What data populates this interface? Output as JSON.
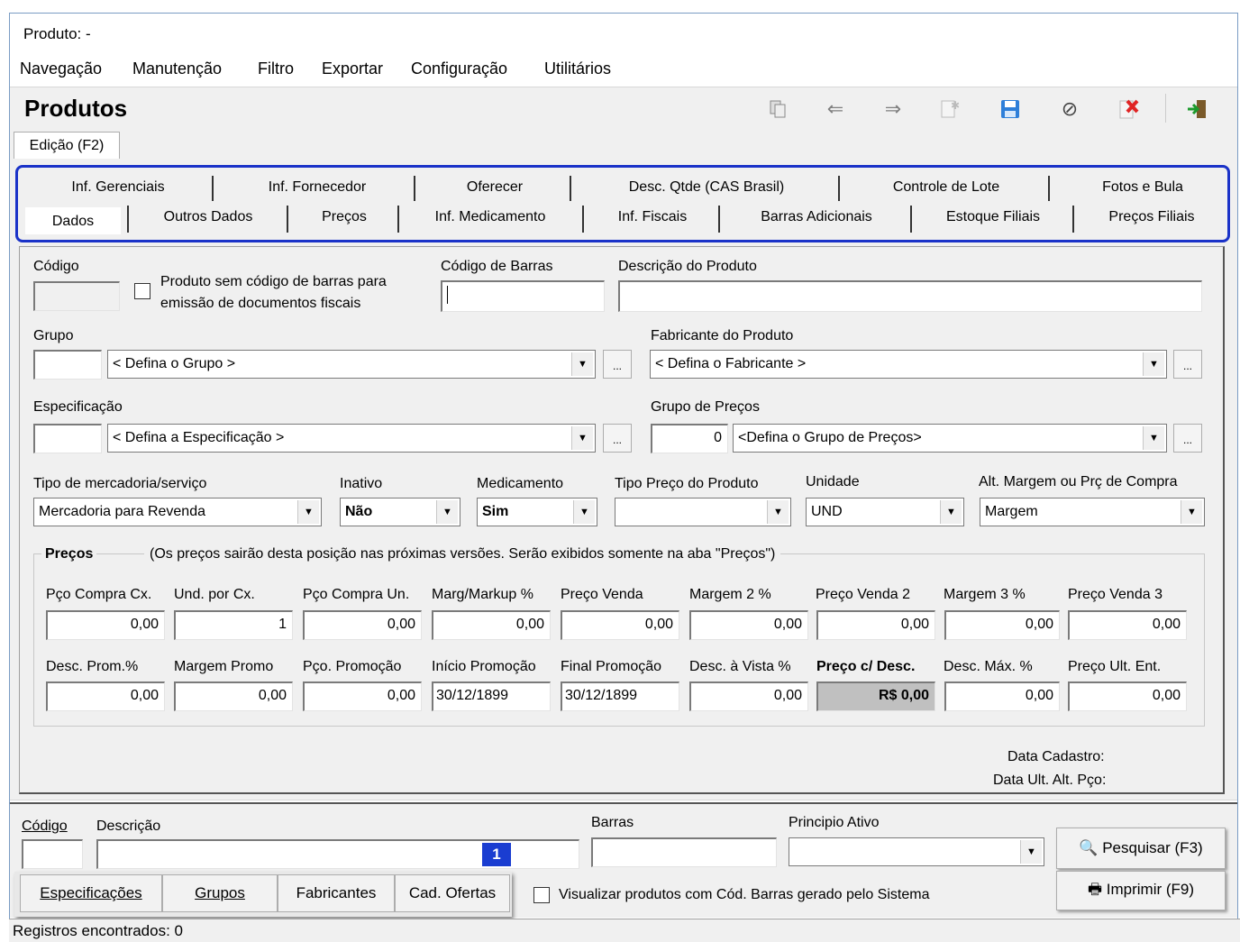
{
  "window": {
    "title": "Produto: -"
  },
  "menu": [
    "Navegação",
    "Manutenção",
    "Filtro",
    "Exportar",
    "Configuração",
    "Utilitários"
  ],
  "header": {
    "title": "Produtos"
  },
  "toolbar_icons": [
    "copy-icon",
    "arrow-left-icon",
    "arrow-right-icon",
    "new-record-icon",
    "save-icon",
    "cancel-icon",
    "delete-icon",
    "exit-icon"
  ],
  "edit_tab": "Edição (F2)",
  "tabs_row1": [
    "Inf. Gerenciais",
    "Inf. Fornecedor",
    "Oferecer",
    "Desc. Qtde (CAS Brasil)",
    "Controle de Lote",
    "Fotos e Bula"
  ],
  "tabs_row2": [
    "Dados",
    "Outros Dados",
    "Preços",
    "Inf. Medicamento",
    "Inf. Fiscais",
    "Barras Adicionais",
    "Estoque Filiais",
    "Preços Filiais"
  ],
  "form": {
    "codigo_label": "Código",
    "sem_barras_line1": "Produto sem código de barras para",
    "sem_barras_line2": "emissão de documentos fiscais",
    "codigo_barras_label": "Código de Barras",
    "descricao_label": "Descrição do Produto",
    "grupo_label": "Grupo",
    "grupo_value": "< Defina o Grupo >",
    "fabricante_label": "Fabricante do Produto",
    "fabricante_value": "< Defina o Fabricante >",
    "especificacao_label": "Especificação",
    "especificacao_value": "< Defina a Especificação >",
    "grupo_precos_label": "Grupo de Preços",
    "grupo_precos_code": "0",
    "grupo_precos_value": "<Defina o Grupo de Preços>",
    "dots": "...",
    "tipo_merc_label": "Tipo de mercadoria/serviço",
    "tipo_merc_value": "Mercadoria para Revenda",
    "inativo_label": "Inativo",
    "inativo_value": "Não",
    "medicamento_label": "Medicamento",
    "medicamento_value": "Sim",
    "tipo_preco_label": "Tipo Preço do Produto",
    "tipo_preco_value": "",
    "unidade_label": "Unidade",
    "unidade_value": "UND",
    "alt_margem_label": "Alt. Margem ou Prç de Compra",
    "alt_margem_value": "Margem"
  },
  "precos": {
    "group_title": "Preços",
    "group_note": "(Os preços sairão desta posição nas próximas versões. Serão exibidos somente na aba \"Preços\")",
    "row1": [
      {
        "label": "Pço Compra Cx.",
        "value": "0,00"
      },
      {
        "label": "Und. por Cx.",
        "value": "1"
      },
      {
        "label": "Pço Compra Un.",
        "value": "0,00"
      },
      {
        "label": "Marg/Markup %",
        "value": "0,00"
      },
      {
        "label": "Preço Venda",
        "value": "0,00"
      },
      {
        "label": "Margem 2 %",
        "value": "0,00"
      },
      {
        "label": "Preço Venda 2",
        "value": "0,00"
      },
      {
        "label": "Margem 3 %",
        "value": "0,00"
      },
      {
        "label": "Preço Venda 3",
        "value": "0,00"
      }
    ],
    "row2": [
      {
        "label": "Desc. Prom.%",
        "value": "0,00"
      },
      {
        "label": "Margem Promo",
        "value": "0,00"
      },
      {
        "label": "Pço. Promoção",
        "value": "0,00"
      },
      {
        "label": "Início Promoção",
        "value": "30/12/1899"
      },
      {
        "label": "Final Promoção",
        "value": "30/12/1899"
      },
      {
        "label": "Desc. à Vista %",
        "value": "0,00"
      },
      {
        "label": "Preço c/ Desc.",
        "value": "R$ 0,00"
      },
      {
        "label": "Desc. Máx. %",
        "value": "0,00"
      },
      {
        "label": "Preço Ult. Ent.",
        "value": "0,00"
      }
    ]
  },
  "info": {
    "data_cadastro": "Data Cadastro:",
    "data_ult_alt": "Data Ult. Alt. Pço:"
  },
  "search": {
    "codigo_label": "Código",
    "descricao_label": "Descrição",
    "barras_label": "Barras",
    "principio_label": "Principio Ativo",
    "badge": "1",
    "pesquisar": "Pesquisar (F3)",
    "imprimir": "Imprimir (F9)",
    "visualizar_label": "Visualizar produtos com Cód. Barras gerado pelo Sistema"
  },
  "bottom_buttons": [
    "Especificações",
    "Grupos",
    "Fabricantes",
    "Cad. Ofertas"
  ],
  "status": {
    "text": "Registros encontrados: 0"
  },
  "colors": {
    "highlight_border": "#1a32c8",
    "badge_bg": "#1a3dd1",
    "panel_bg": "#f0f0f0"
  }
}
